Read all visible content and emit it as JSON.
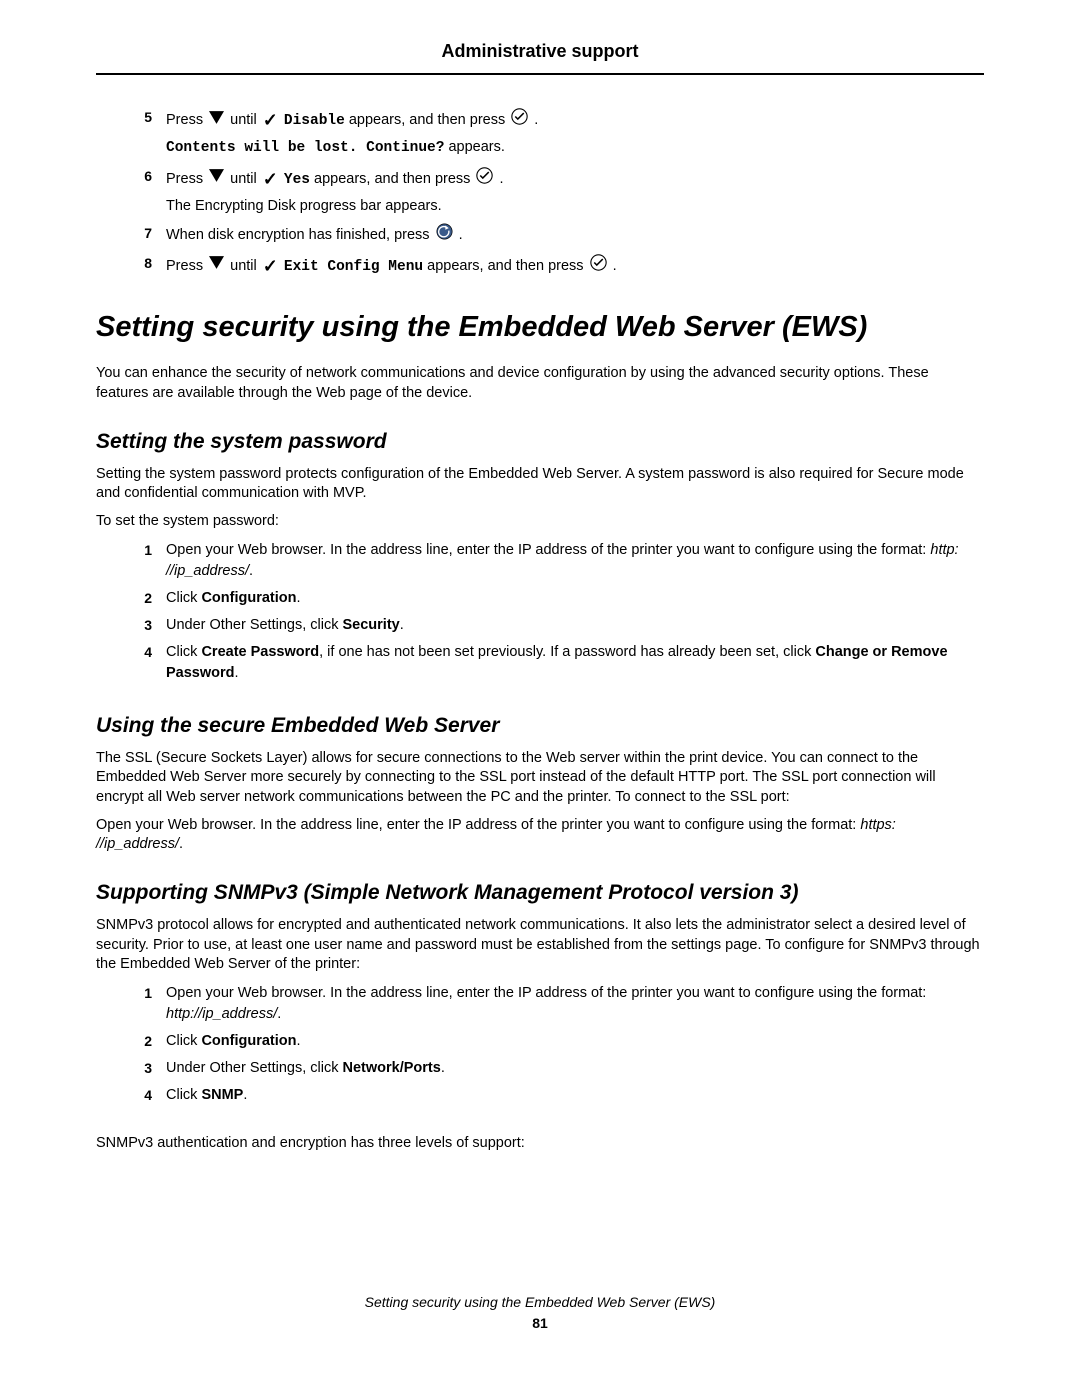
{
  "header": {
    "title": "Administrative support"
  },
  "top_steps": [
    {
      "num": "5",
      "pre": "Press ",
      "mid": " until ",
      "cmd": "Disable",
      "after": " appears, and then press ",
      "tail": ".",
      "sub_mono": "Contents will be lost. Continue?",
      "sub_tail": " appears."
    },
    {
      "num": "6",
      "pre": "Press ",
      "mid": " until ",
      "cmd": "Yes",
      "after": " appears, and then press ",
      "tail": ".",
      "sub_plain": "The Encrypting Disk progress bar appears."
    },
    {
      "num": "7",
      "pre": "When disk encryption has finished, press ",
      "tail": ".",
      "use_back": true
    },
    {
      "num": "8",
      "pre": "Press ",
      "mid": " until ",
      "cmd": "Exit Config Menu",
      "after": " appears, and then press ",
      "tail": "."
    }
  ],
  "section1": {
    "title": "Setting security using the Embedded Web Server (EWS)",
    "para1": "You can enhance the security of network communications and device configuration by using the advanced security options. These features are available through the Web page of the device."
  },
  "section2": {
    "title": "Setting the system password",
    "para1": "Setting the system password protects configuration of the Embedded Web Server. A system password is also required for Secure mode and confidential communication with MVP.",
    "para2": "To set the system password:",
    "steps": [
      {
        "num": "1",
        "text_a": "Open your Web browser. In the address line, enter the IP address of the printer you want to configure using the format: ",
        "italic": "http: //ip_address/",
        "text_b": "."
      },
      {
        "num": "2",
        "text_a": "Click ",
        "bold": "Configuration",
        "text_b": "."
      },
      {
        "num": "3",
        "text_a": "Under Other Settings, click ",
        "bold": "Security",
        "text_b": "."
      },
      {
        "num": "4",
        "text_a": "Click ",
        "bold": "Create Password",
        "text_b": ", if one has not been set previously. If a password has already been set, click ",
        "bold2": "Change or Remove Password",
        "text_c": "."
      }
    ]
  },
  "section3": {
    "title": "Using the secure Embedded Web Server",
    "para1": "The SSL (Secure Sockets Layer) allows for secure connections to the Web server within the print device. You can connect to the Embedded Web Server more securely by connecting to the SSL port instead of the default HTTP port. The SSL port connection will encrypt all Web server network communications between the PC and the printer. To connect to the SSL port:",
    "para2_a": "Open your Web browser. In the address line, enter the IP address of the printer you want to configure using the format: ",
    "para2_italic": "https: //ip_address/",
    "para2_b": "."
  },
  "section4": {
    "title": "Supporting SNMPv3 (Simple Network Management Protocol version 3)",
    "para1": "SNMPv3 protocol allows for encrypted and authenticated network communications. It also lets the administrator select a desired level of security. Prior to use, at least one user name and password must be established from the settings page. To configure for SNMPv3 through the Embedded Web Server of the printer:",
    "steps": [
      {
        "num": "1",
        "text_a": "Open your Web browser. In the address line, enter the IP address of the printer you want to configure using the format: ",
        "italic": "http://ip_address/",
        "text_b": "."
      },
      {
        "num": "2",
        "text_a": "Click ",
        "bold": "Configuration",
        "text_b": "."
      },
      {
        "num": "3",
        "text_a": "Under Other Settings, click ",
        "bold": "Network/Ports",
        "text_b": "."
      },
      {
        "num": "4",
        "text_a": "Click ",
        "bold": "SNMP",
        "text_b": "."
      }
    ],
    "para2": "SNMPv3 authentication and encryption has three levels of support:"
  },
  "footer": {
    "title": "Setting security using the Embedded Web Server (EWS)",
    "page": "81"
  }
}
